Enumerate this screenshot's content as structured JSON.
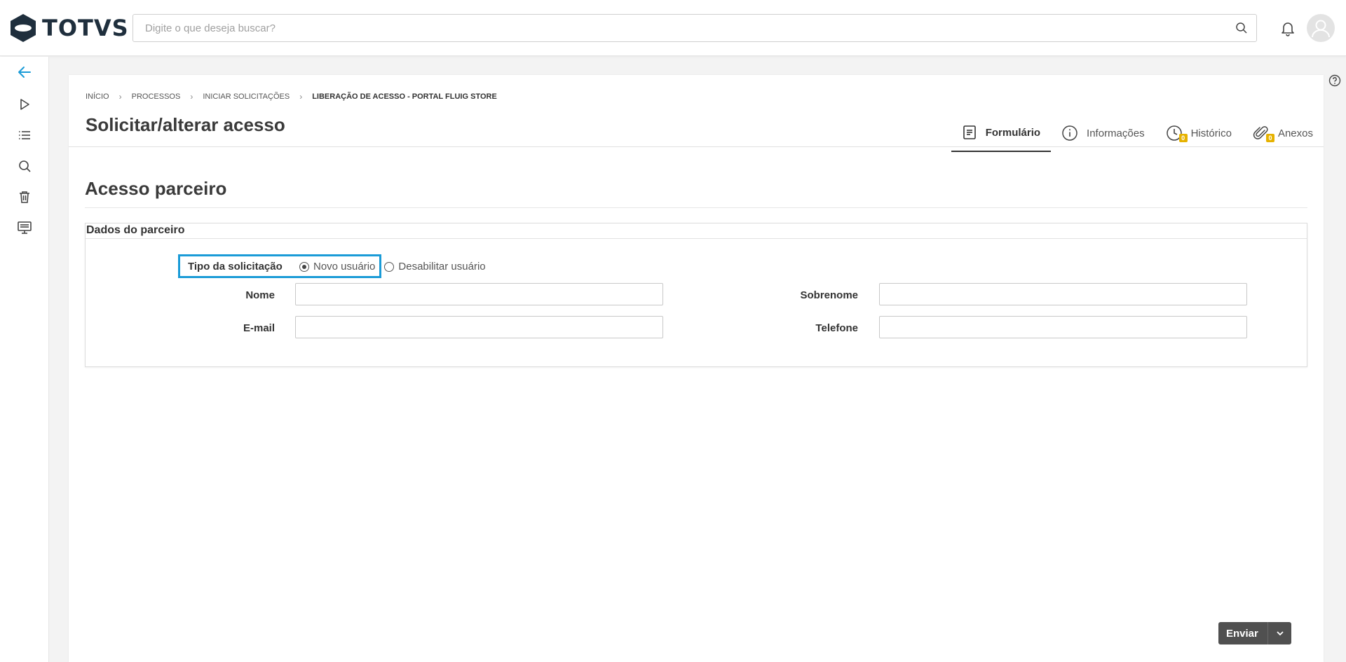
{
  "app": {
    "logo_text": "TOTVS",
    "search_placeholder": "Digite o que deseja buscar?"
  },
  "breadcrumb": [
    "Início",
    "Processos",
    "Iniciar solicitações",
    "Liberação de acesso - Portal Fluig Store"
  ],
  "page": {
    "title": "Solicitar/alterar acesso"
  },
  "tabs": [
    {
      "label": "Formulário",
      "icon": "form-icon",
      "active": true
    },
    {
      "label": "Informações",
      "icon": "info-icon",
      "active": false
    },
    {
      "label": "Histórico",
      "icon": "clock-icon",
      "badge": "0",
      "active": false
    },
    {
      "label": "Anexos",
      "icon": "paperclip-icon",
      "badge": "0",
      "active": false
    }
  ],
  "form": {
    "section_title": "Acesso parceiro",
    "panel_title": "Dados do parceiro",
    "tipo_label": "Tipo da solicitação",
    "tipo_options": [
      {
        "label": "Novo usuário",
        "selected": true
      },
      {
        "label": "Desabilitar usuário",
        "selected": false
      }
    ],
    "nome_label": "Nome",
    "nome_value": "",
    "sobrenome_label": "Sobrenome",
    "sobrenome_value": "",
    "email_label": "E-mail",
    "email_value": "",
    "telefone_label": "Telefone",
    "telefone_value": ""
  },
  "actions": {
    "send_label": "Enviar"
  },
  "colors": {
    "highlight": "#1a9bd7",
    "badge": "#e6b200",
    "rail_active": "#1a9bd7",
    "button_bg": "#505050"
  }
}
